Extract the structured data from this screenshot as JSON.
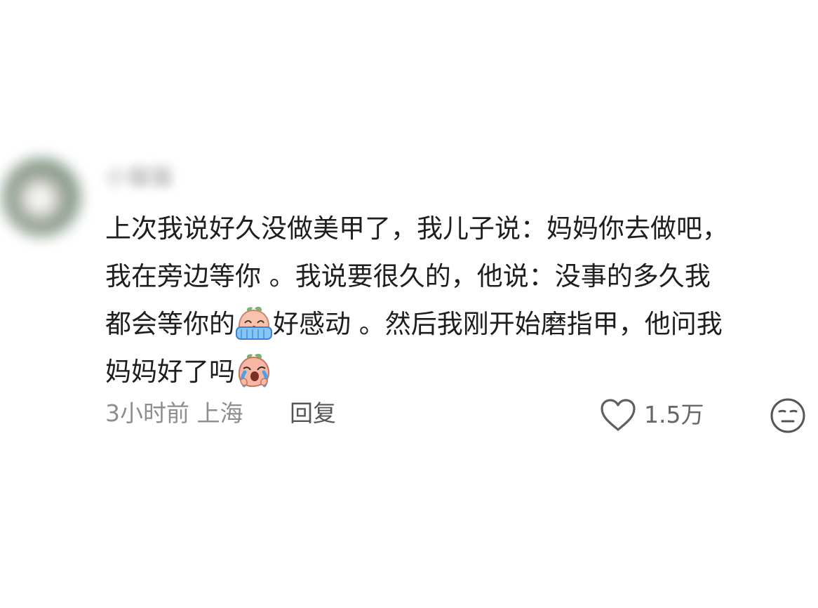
{
  "comment": {
    "author": {
      "name": "小猫猫"
    },
    "text_lines": [
      {
        "segments": [
          "上次我说好久没做美甲了，我儿子说：妈妈你去做吧，"
        ]
      },
      {
        "segments": [
          "我在旁边等你 。我说要很久的，他说：没事的多久我"
        ]
      },
      {
        "segments": [
          "都会等你的",
          "好感动 。然后我刚开始磨指甲，他问我"
        ],
        "emoji": "crying-peach-emoji"
      },
      {
        "segments": [
          "妈妈好了吗"
        ],
        "emoji": "sobbing-peach-emoji"
      }
    ],
    "meta": "3小时前 上海",
    "reply_label": "回复",
    "like_count": "1.5万",
    "like_icon": "heart-outline-icon",
    "reaction_icon": "neutral-face-icon"
  },
  "colors": {
    "text": "#1e1e1e",
    "meta": "#8e8e8e",
    "icon": "#666666",
    "emoji_skin": "#f7b9a3",
    "emoji_tear": "#4aa3ea",
    "emoji_leaf": "#78b56a"
  }
}
